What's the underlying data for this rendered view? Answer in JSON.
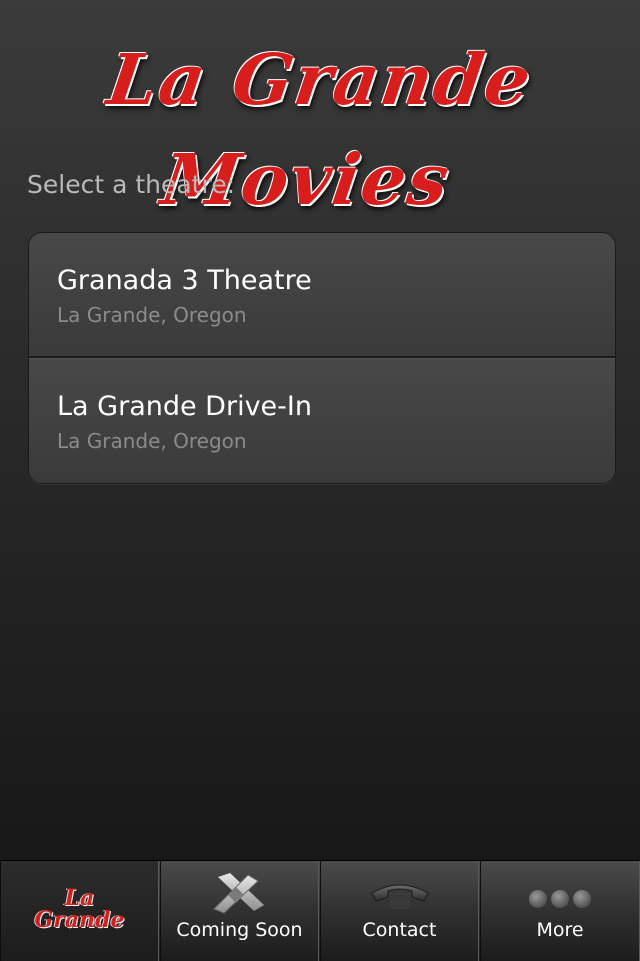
{
  "header": {
    "logo_text": "La Grande Movies"
  },
  "main": {
    "prompt": "Select a theatre:",
    "theatres": [
      {
        "name": "Granada 3 Theatre",
        "location": "La Grande, Oregon"
      },
      {
        "name": "La Grande Drive-In",
        "location": "La Grande, Oregon"
      }
    ]
  },
  "tabbar": {
    "home_logo_line1": "La",
    "home_logo_line2": "Grande",
    "tabs": [
      {
        "label": "Coming Soon",
        "icon": "clapperboard-icon"
      },
      {
        "label": "Contact",
        "icon": "phone-icon"
      },
      {
        "label": "More",
        "icon": "more-dots-icon"
      }
    ]
  },
  "colors": {
    "logo_red": "#d81d1d",
    "background": "#2a2a2a"
  }
}
